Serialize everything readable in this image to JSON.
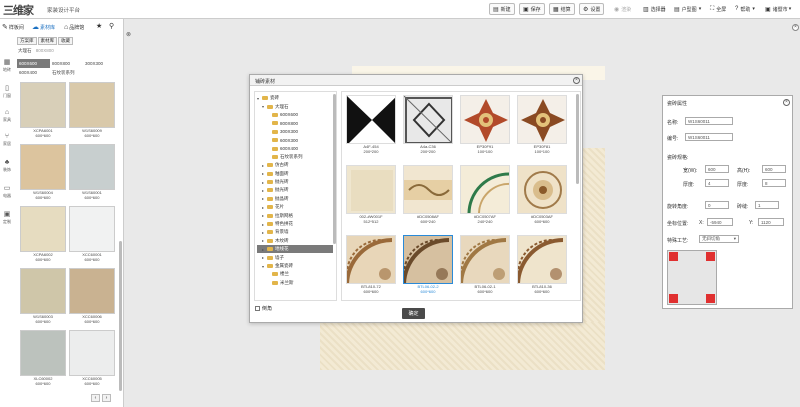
{
  "topbar": {
    "logo_text": "三维家",
    "platform_name": "家装设计平台",
    "buttons": [
      {
        "icon": "new-file-icon",
        "label": "新建"
      },
      {
        "icon": "save-icon",
        "label": "保存"
      },
      {
        "icon": "quote-icon",
        "label": "结算"
      },
      {
        "icon": "settings-icon",
        "label": "设置"
      }
    ],
    "render_label": "渲染",
    "select_label": "选择器",
    "view_label": "户型图",
    "fullscreen_label": "全屏",
    "help_label": "帮助",
    "user_label": "诸暨市"
  },
  "leftpanel": {
    "tabs": [
      {
        "icon": "pencil-icon",
        "label": "样板间"
      },
      {
        "icon": "cloud-icon",
        "label": "素材库"
      },
      {
        "icon": "tag-icon",
        "label": "品牌馆"
      }
    ],
    "subtabs": [
      "方案库",
      "素材库",
      "收藏"
    ],
    "breadcrumb": "大理石",
    "breadcrumb_sub": "800X800",
    "sizes": [
      "600X600",
      "800X800",
      "300X300",
      "600X400",
      "石纹装系列"
    ],
    "vnav": [
      {
        "icon": "floor-icon",
        "label": "地砖"
      },
      {
        "icon": "door-icon",
        "label": "门窗"
      },
      {
        "icon": "bed-icon",
        "label": "家具"
      },
      {
        "icon": "chair-icon",
        "label": "家居"
      },
      {
        "icon": "plant-icon",
        "label": "装饰"
      },
      {
        "icon": "tv-icon",
        "label": "电器"
      },
      {
        "icon": "custom-icon",
        "label": "定制"
      }
    ],
    "tiles": [
      {
        "code": "XCPA6001",
        "size": "600*600",
        "color": "#d8cfb8"
      },
      {
        "code": "W1S60009",
        "size": "600*600",
        "color": "#d9c9aa"
      },
      {
        "code": "W1S60004",
        "size": "600*600",
        "color": "#dcc49e"
      },
      {
        "code": "W1S60001",
        "size": "600*600",
        "color": "#c8cfcf"
      },
      {
        "code": "XCPA6002",
        "size": "600*600",
        "color": "#e6dcc0"
      },
      {
        "code": "XCC60001",
        "size": "600*600",
        "color": "#f1f2f2"
      },
      {
        "code": "W1S60003",
        "size": "600*600",
        "color": "#cfc6a9"
      },
      {
        "code": "XCC60006",
        "size": "600*600",
        "color": "#c9b291"
      },
      {
        "code": "XLC60002",
        "size": "600*600",
        "color": "#bcc2bd"
      },
      {
        "code": "XCC60005",
        "size": "600*600",
        "color": "#eceded"
      }
    ]
  },
  "dialog": {
    "title": "铺砖素材",
    "tree": [
      {
        "label": "瓷砖",
        "level": 0,
        "expanded": true
      },
      {
        "label": "大理石",
        "level": 1,
        "expanded": true
      },
      {
        "label": "600X600",
        "level": 2
      },
      {
        "label": "800X800",
        "level": 2
      },
      {
        "label": "300X300",
        "level": 2
      },
      {
        "label": "600X300",
        "level": 2
      },
      {
        "label": "600X400",
        "level": 2
      },
      {
        "label": "石纹装系列",
        "level": 2
      },
      {
        "label": "仿古砖",
        "level": 1
      },
      {
        "label": "釉面砖",
        "level": 1
      },
      {
        "label": "抛光砖",
        "level": 1
      },
      {
        "label": "抛光砖",
        "level": 1
      },
      {
        "label": "抛晶砖",
        "level": 1
      },
      {
        "label": "花片",
        "level": 1
      },
      {
        "label": "拉斯网格",
        "level": 1
      },
      {
        "label": "特色拼花",
        "level": 1
      },
      {
        "label": "背景墙",
        "level": 1
      },
      {
        "label": "木纹砖",
        "level": 1
      },
      {
        "label": "地线花",
        "level": 1,
        "selected": true
      },
      {
        "label": "墙子",
        "level": 1
      },
      {
        "label": "金属瓷砖",
        "level": 1,
        "expanded": true
      },
      {
        "label": "楼兰",
        "level": 2
      },
      {
        "label": "米兰斯",
        "level": 2
      }
    ],
    "grid": [
      {
        "code": "A4F-454",
        "size": "200*200",
        "pattern": "bw",
        "highlight": false
      },
      {
        "code": "A4a-C36",
        "size": "200*200",
        "pattern": "grey",
        "highlight": false
      },
      {
        "code": "EP30F91",
        "size": "100*100",
        "pattern": "star-red",
        "highlight": false
      },
      {
        "code": "EP30F81",
        "size": "100*100",
        "pattern": "star-brown",
        "highlight": false
      },
      {
        "code": "002-#W001F",
        "size": "512*512",
        "pattern": "beige",
        "highlight": false
      },
      {
        "code": "#DC0508AF",
        "size": "600*240",
        "pattern": "border",
        "highlight": false
      },
      {
        "code": "#DC0507AF",
        "size": "240*240",
        "pattern": "arc-green",
        "highlight": false
      },
      {
        "code": "#DC0503AF",
        "size": "600*600",
        "pattern": "medallion",
        "highlight": false
      },
      {
        "code": "BTL810-72",
        "size": "600*600",
        "pattern": "ornate",
        "highlight": false
      },
      {
        "code": "BTL06-02-2",
        "size": "600*600",
        "pattern": "ornate2",
        "highlight": true
      },
      {
        "code": "BTL06-02-1",
        "size": "600*600",
        "pattern": "ornate3",
        "highlight": false
      },
      {
        "code": "BTL810-36",
        "size": "600*600",
        "pattern": "ornate4",
        "highlight": false
      }
    ],
    "checkbox_label": "倒角",
    "ok_label": "确定"
  },
  "props": {
    "title": "瓷砖属性",
    "name_label": "名称:",
    "name_value": "W1S60011",
    "code_label": "编号:",
    "code_value": "W1S60011",
    "spec_label": "瓷砖规格:",
    "width_label": "宽(W):",
    "width_value": "600",
    "height_label": "高(H):",
    "height_value": "600",
    "thickness_label": "厚度:",
    "thickness_value": "4",
    "depth_label": "厚度:",
    "depth_value": "8",
    "rotate_label": "旋转角度:",
    "rotate_value": "0",
    "gap_label": "砖缝:",
    "gap_value": "1",
    "pos_label": "坐标位置:",
    "x_label": "X:",
    "x_value": "-5940",
    "y_label": "Y:",
    "y_value": "1120",
    "special_label": "特殊工艺:",
    "special_value": "无斜切角",
    "corner_color": "#e03030"
  }
}
